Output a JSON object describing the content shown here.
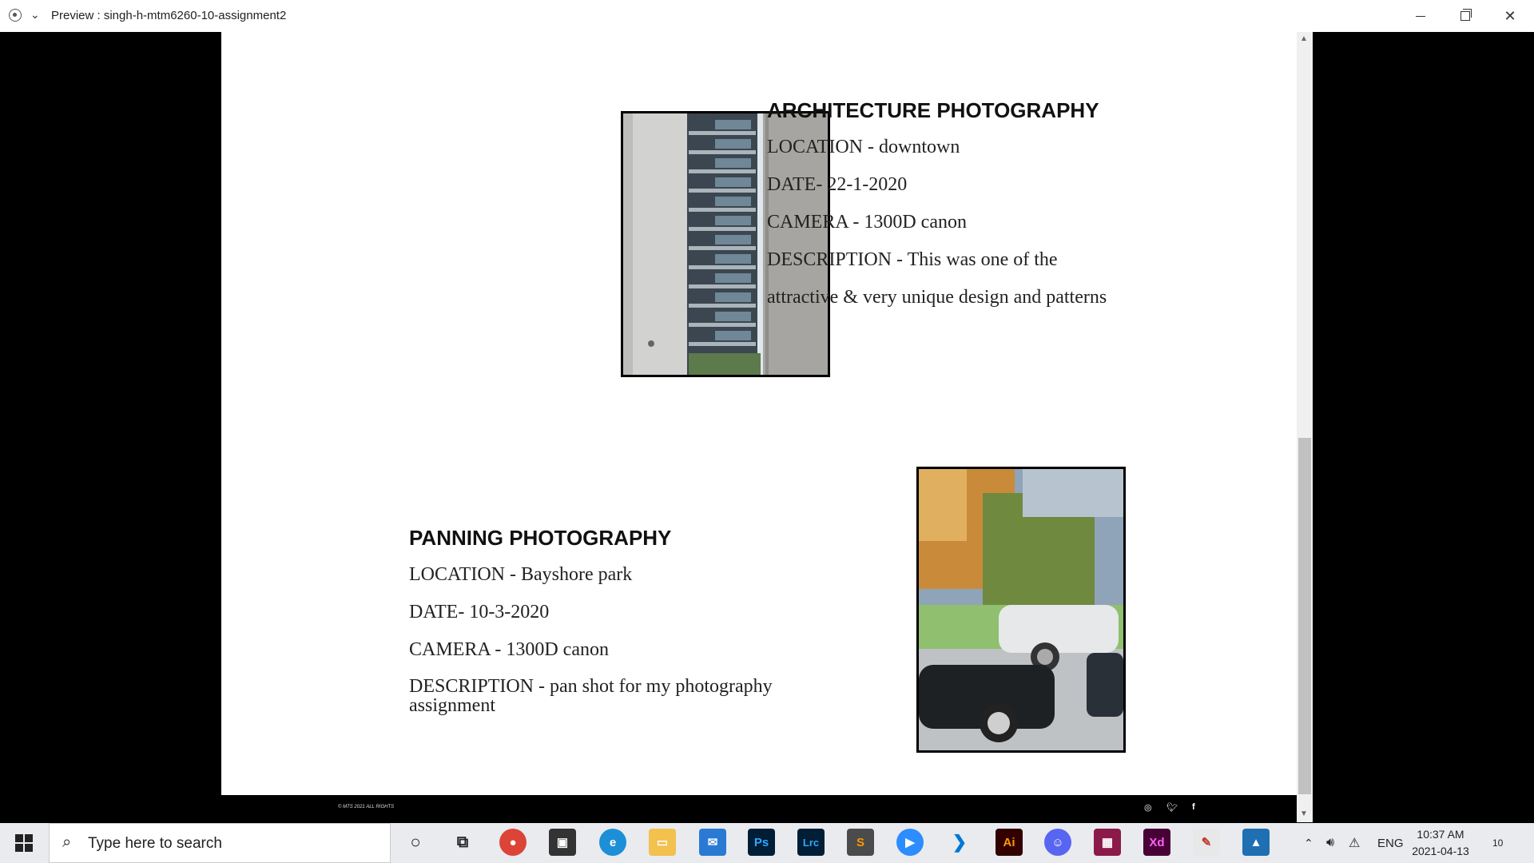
{
  "window": {
    "title": "Preview : singh-h-mtm6260-10-assignment2"
  },
  "architecture": {
    "heading": "ARCHITECTURE PHOTOGRAPHY",
    "location": "LOCATION - downtown",
    "date": "DATE- 22-1-2020",
    "camera": "CAMERA - 1300D canon",
    "description_line1": "DESCRIPTION - This was one of the",
    "description_line2": "attractive & very unique design and patterns"
  },
  "panning": {
    "heading": "PANNING PHOTOGRAPHY",
    "location": "LOCATION - Bayshore park",
    "date": "DATE- 10-3-2020",
    "camera": "CAMERA - 1300D canon",
    "description_line1": "DESCRIPTION - pan shot for my photography",
    "description_line2": "assignment"
  },
  "footer": {
    "copyright": "© MTS 2021 ALL RIGHTS",
    "social": [
      "instagram-icon",
      "twitter-icon",
      "facebook-icon"
    ]
  },
  "taskbar": {
    "search_placeholder": "Type here to search",
    "apps": [
      "chrome",
      "store",
      "edge",
      "file-explorer",
      "mail",
      "photoshop",
      "lightroom-classic",
      "sublime",
      "zoom",
      "vscode",
      "illustrator",
      "discord",
      "winrar",
      "xd",
      "paint",
      "photos"
    ],
    "language": "ENG",
    "time": "10:37 AM",
    "date": "2021-04-13",
    "notifications": "10"
  }
}
